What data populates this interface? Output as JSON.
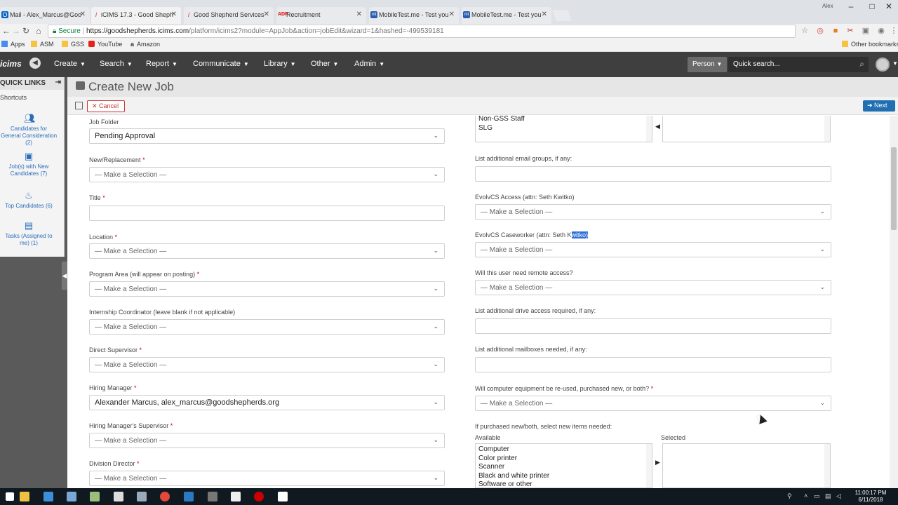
{
  "browser": {
    "tabs": [
      {
        "title": "Mail - Alex_Marcus@Goo",
        "icon": "outlook-icon",
        "active": false
      },
      {
        "title": "iCIMS 17.3 - Good Sheph",
        "icon": "icims-icon",
        "active": true
      },
      {
        "title": "Good Shepherd Services",
        "icon": "icims-icon",
        "active": false
      },
      {
        "title": "Recruitment",
        "icon": "adp-icon",
        "active": false
      },
      {
        "title": "MobileTest.me - Test you",
        "icon": "mobiletest-icon",
        "active": false
      },
      {
        "title": "MobileTest.me - Test you",
        "icon": "mobiletest-icon",
        "active": false
      }
    ],
    "profile_name": "Alex",
    "secure_label": "Secure",
    "url_host": "https://goodshepherds.icims.com",
    "url_rest": "/platform/icims2?module=AppJob&action=jobEdit&wizard=1&hashed=-499539181",
    "bookmarks": [
      "Apps",
      "ASM",
      "GSS",
      "YouTube",
      "Amazon"
    ],
    "other_bookmarks": "Other bookmarks"
  },
  "topnav": {
    "logo": "icims",
    "menus": [
      "Create",
      "Search",
      "Report",
      "Communicate",
      "Library",
      "Other",
      "Admin"
    ],
    "person_select": "Person",
    "quick_search_placeholder": "Quick search..."
  },
  "page": {
    "title": "Create New Job",
    "cancel_label": "Cancel",
    "next_label": "Next"
  },
  "sidebar": {
    "header": "QUICK LINKS",
    "shortcuts_label": "Shortcuts",
    "items": [
      {
        "label": "Candidates for General Consideration (2)",
        "icon": "people-icon"
      },
      {
        "label": "Job(s) with New Candidates (7)",
        "icon": "job-icon"
      },
      {
        "label": "Top Candidates (6)",
        "icon": "flame-icon"
      },
      {
        "label": "Tasks (Assigned to me) (1)",
        "icon": "clipboard-icon"
      }
    ]
  },
  "form": {
    "left": [
      {
        "label": "Job Folder",
        "required": false,
        "value": "Pending Approval",
        "filled": true
      },
      {
        "label": "New/Replacement",
        "required": true,
        "value": "— Make a Selection —",
        "filled": false
      },
      {
        "label": "Title",
        "required": true,
        "value": "",
        "type": "text"
      },
      {
        "label": "Location",
        "required": true,
        "value": "— Make a Selection —",
        "filled": false
      },
      {
        "label": "Program Area (will appear on posting)",
        "required": true,
        "value": "— Make a Selection —",
        "filled": false
      },
      {
        "label": "Internship Coordinator (leave blank if not applicable)",
        "required": false,
        "value": "— Make a Selection —",
        "filled": false
      },
      {
        "label": "Direct Supervisor",
        "required": true,
        "value": "— Make a Selection —",
        "filled": false
      },
      {
        "label": "Hiring Manager",
        "required": true,
        "value": "Alexander Marcus, alex_marcus@goodshepherds.org",
        "filled": true
      },
      {
        "label": "Hiring Manager's Supervisor",
        "required": true,
        "value": "— Make a Selection —",
        "filled": false
      },
      {
        "label": "Division Director",
        "required": true,
        "value": "— Make a Selection —",
        "filled": false
      }
    ],
    "right": {
      "email_groups_list": [
        "Non-GSS Staff",
        "SLG"
      ],
      "additional_email_label": "List additional email groups, if any:",
      "evolv_access_label": "EvolvCS Access (attn: Seth Kwitko)",
      "evolv_access_value": "— Make a Selection —",
      "evolv_caseworker_label_pre": "EvolvCS Caseworker (attn: Seth K",
      "evolv_caseworker_label_hl": "witko)",
      "evolv_caseworker_value": "— Make a Selection —",
      "remote_access_label": "Will this user need remote access?",
      "remote_access_value": "— Make a Selection —",
      "drive_access_label": "List additional drive access required, if any:",
      "mailboxes_label": "List additional mailboxes needed, if any:",
      "equipment_label": "Will computer equipment be re-used, purchased new, or both?",
      "equipment_value": "— Make a Selection —",
      "new_items_label": "If purchased new/both, select new items needed:",
      "available_label": "Available",
      "selected_label": "Selected",
      "available_items": [
        "Computer",
        "Color printer",
        "Scanner",
        "Black and white printer",
        "Software or other"
      ]
    }
  },
  "taskbar": {
    "time": "11:00:17 PM",
    "date": "6/11/2018"
  }
}
